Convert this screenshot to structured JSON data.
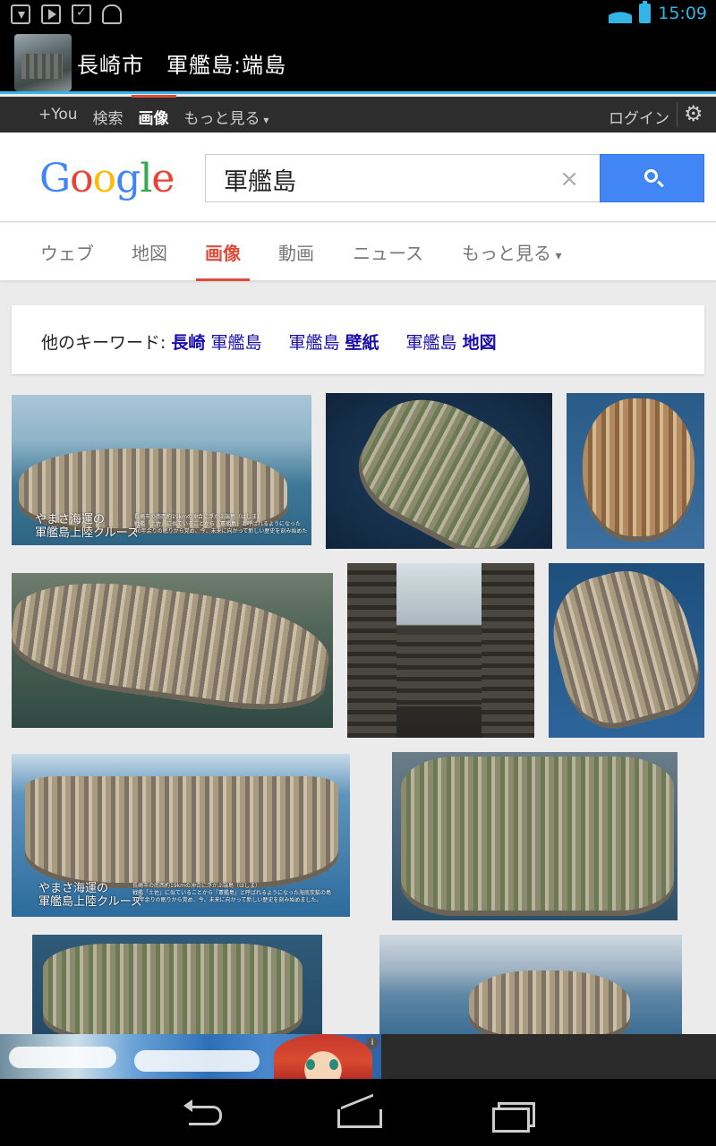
{
  "app": {
    "title": "長崎市　軍艦島:端島",
    "time": "15:09"
  },
  "gbar": {
    "items": [
      "+You",
      "検索",
      "画像",
      "もっと見る"
    ],
    "active_index": 2,
    "login": "ログイン"
  },
  "search": {
    "logo": "Google",
    "query": "軍艦島",
    "clear": "×"
  },
  "tabs": {
    "items": [
      "ウェブ",
      "地図",
      "画像",
      "動画",
      "ニュース",
      "もっと見る"
    ],
    "active_index": 2
  },
  "keywords": {
    "label": "他のキーワード:",
    "suggestions": [
      {
        "prefix": "長崎",
        "suffix": " 軍艦島",
        "bold": "prefix"
      },
      {
        "prefix": "軍艦島 ",
        "suffix": "壁紙",
        "bold": "suffix"
      },
      {
        "prefix": "軍艦島 ",
        "suffix": "地図",
        "bold": "suffix"
      }
    ]
  },
  "images": {
    "captions": {
      "img1_big": "やまさ海運の\n軍艦島上陸クルーズ",
      "img1_small": "長崎市の南西約19kmの沖合に浮かぶ端島（はしま）\n戦艦「土佐」に似ていることから「軍艦島」と呼ばれるようになった\n40年余りの眠りから覚め、今、未来に向かって新しい歴史を刻み始めた",
      "img7_big": "やまさ海運の\n軍艦島上陸クルーズ",
      "img7_small": "長崎市の南西約19kmの沖合に浮かぶ端島（はしま）\n戦艦「土佐」に似ていることから「軍艦島」と呼ばれるようになった海底炭鉱の島\n40年余りの眠りから覚め、今、未来に向かって新しい歴史を刻み始めました。"
    }
  },
  "ad": {
    "badge": "i"
  },
  "colors": {
    "accent_red": "#dd4b39",
    "search_blue": "#4285f4",
    "link_blue": "#1a0dab",
    "holo_blue": "#33b5e5"
  }
}
